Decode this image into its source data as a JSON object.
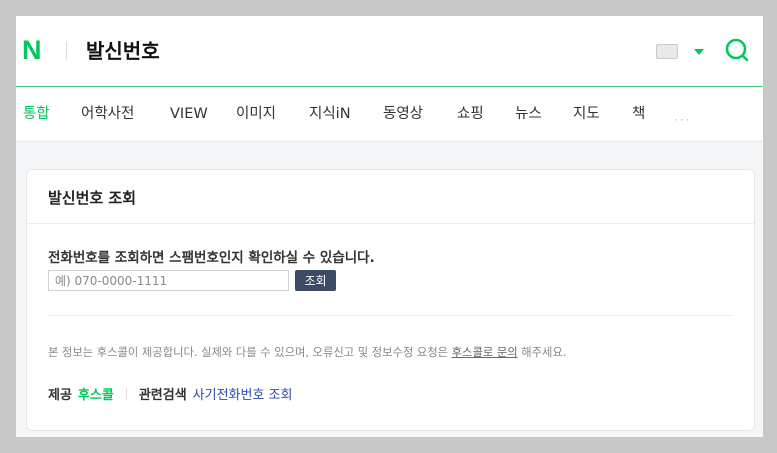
{
  "header": {
    "logo": "N",
    "query": "발신번호",
    "accent_color": "#03c75a",
    "icons": [
      "keyboard-icon",
      "chevron-down-icon",
      "search-icon"
    ]
  },
  "tabs": [
    {
      "label": "통합",
      "active": true
    },
    {
      "label": "어학사전",
      "active": false
    },
    {
      "label": "VIEW",
      "active": false
    },
    {
      "label": "이미지",
      "active": false
    },
    {
      "label": "지식iN",
      "active": false
    },
    {
      "label": "동영상",
      "active": false
    },
    {
      "label": "쇼핑",
      "active": false
    },
    {
      "label": "뉴스",
      "active": false
    },
    {
      "label": "지도",
      "active": false
    },
    {
      "label": "책",
      "active": false
    }
  ],
  "tabs_more": "···",
  "card": {
    "title": "발신번호 조회",
    "description": "전화번호를 조회하면 스팸번호인지 확인하실 수 있습니다.",
    "input_placeholder": "예) 070-0000-1111",
    "button_label": "조회",
    "notice_before": "본 정보는 후스콜이 제공합니다. 실제와 다를 수 있으며, 오류신고 및 정보수정 요청은 ",
    "notice_link": "후스콜로 문의",
    "notice_after": " 해주세요.",
    "provider_label": "제공",
    "provider_name": "후스콜",
    "related_label": "관련검색",
    "related_link": "사기전화번호 조회"
  }
}
